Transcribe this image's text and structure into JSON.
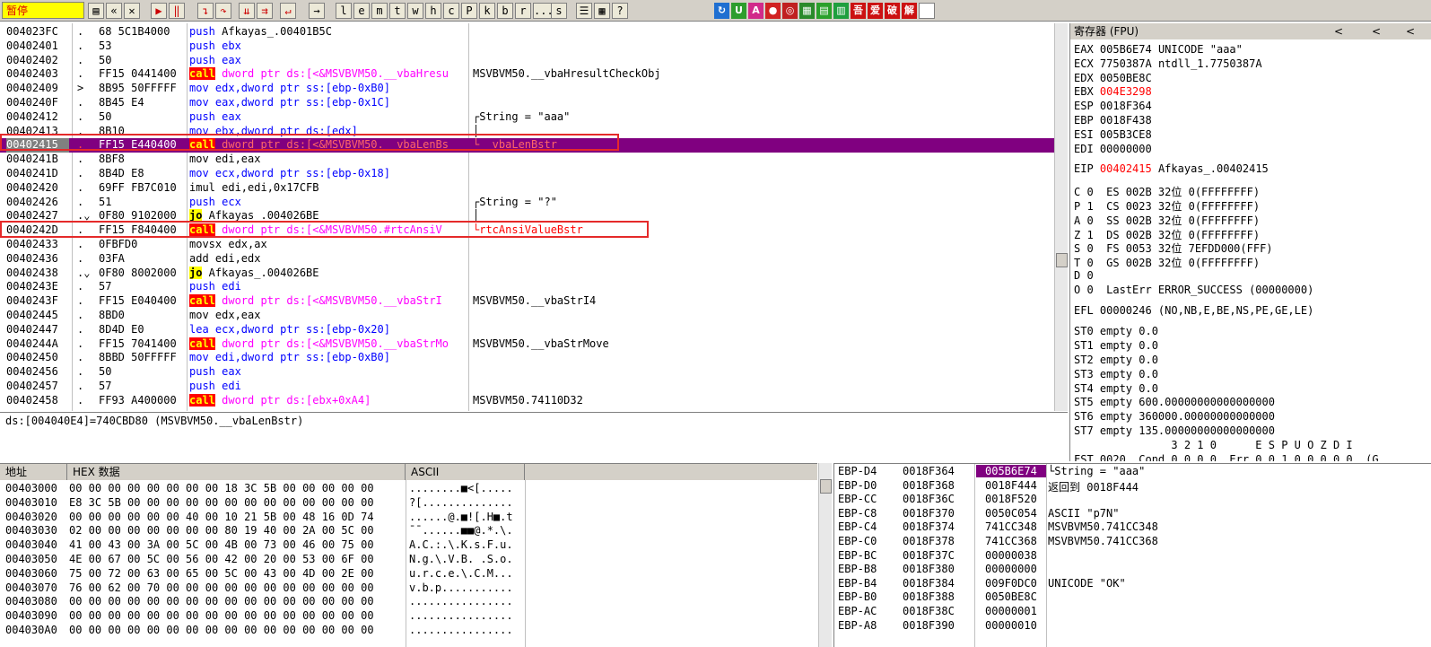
{
  "toolbar": {
    "status": "暂停",
    "buttons": [
      "l",
      "e",
      "m",
      "t",
      "w",
      "h",
      "c",
      "P",
      "k",
      "b",
      "r",
      "...",
      "s"
    ],
    "plugin_buttons": [
      "吾",
      "爱",
      "破",
      "解"
    ]
  },
  "disasm": {
    "rows": [
      {
        "addr": "004023FC",
        "mark": ".",
        "hex": "68 5C1B4000",
        "asm": [
          [
            "push",
            "push"
          ],
          [
            " Afkayas_.00401B5C",
            "plain"
          ]
        ],
        "cmt": ""
      },
      {
        "addr": "00402401",
        "mark": ".",
        "hex": "53",
        "asm": [
          [
            "push",
            "push"
          ],
          [
            " ebx",
            "push"
          ]
        ],
        "cmt": ""
      },
      {
        "addr": "00402402",
        "mark": ".",
        "hex": "50",
        "asm": [
          [
            "push",
            "push"
          ],
          [
            " eax",
            "push"
          ]
        ],
        "cmt": ""
      },
      {
        "addr": "00402403",
        "mark": ".",
        "hex": "FF15 0441400",
        "asm": [
          [
            "call",
            "call"
          ],
          [
            " dword ptr ds:[<&MSVBVM50.__vbaHresu",
            "ds"
          ]
        ],
        "cmt": "MSVBVM50.__vbaHresultCheckObj"
      },
      {
        "addr": "00402409",
        "mark": ">",
        "hex": "8B95 50FFFFF",
        "asm": [
          [
            "mov edx,dword ptr ss:[ebp-0xB0]",
            "ptr"
          ]
        ],
        "cmt": ""
      },
      {
        "addr": "0040240F",
        "mark": ".",
        "hex": "8B45 E4",
        "asm": [
          [
            "mov eax,dword ptr ss:[ebp-0x1C]",
            "ptr"
          ]
        ],
        "cmt": ""
      },
      {
        "addr": "00402412",
        "mark": ".",
        "hex": "50",
        "asm": [
          [
            "push",
            "push"
          ],
          [
            " eax",
            "push"
          ]
        ],
        "cmt": "┌String = \"aaa\""
      },
      {
        "addr": "00402413",
        "mark": ".",
        "hex": "8B10",
        "asm": [
          [
            "mov ebx,dword ptr ds:[edx]",
            "ptr"
          ]
        ],
        "cmt": "│"
      },
      {
        "addr": "00402415",
        "mark": ".",
        "hex": "FF15 E440400",
        "asm": [
          [
            "call",
            "call"
          ],
          [
            " dword ptr ds:[<&MSVBVM50.__vbaLenBs",
            "ds"
          ]
        ],
        "cmt": "└__vbaLenBstr",
        "hi": true
      },
      {
        "addr": "0040241B",
        "mark": ".",
        "hex": "8BF8",
        "asm": [
          [
            "mov edi,eax",
            "plain"
          ]
        ],
        "cmt": ""
      },
      {
        "addr": "0040241D",
        "mark": ".",
        "hex": "8B4D E8",
        "asm": [
          [
            "mov ecx,dword ptr ss:[ebp-0x18]",
            "ptr"
          ]
        ],
        "cmt": ""
      },
      {
        "addr": "00402420",
        "mark": ".",
        "hex": "69FF FB7C010",
        "asm": [
          [
            "imul edi,edi,0x17CFB",
            "plain"
          ]
        ],
        "cmt": ""
      },
      {
        "addr": "00402426",
        "mark": ".",
        "hex": "51",
        "asm": [
          [
            "push",
            "push"
          ],
          [
            " ecx",
            "push"
          ]
        ],
        "cmt": "┌String = \"?\""
      },
      {
        "addr": "00402427",
        "mark": ".⌄",
        "hex": "0F80 9102000",
        "asm": [
          [
            "jo",
            "jo"
          ],
          [
            " Afkayas_.004026BE",
            "plain"
          ]
        ],
        "cmt": "│"
      },
      {
        "addr": "0040242D",
        "mark": ".",
        "hex": "FF15 F840400",
        "asm": [
          [
            "call",
            "call"
          ],
          [
            " dword ptr ds:[<&MSVBVM50.#rtcAnsiV",
            "ds"
          ]
        ],
        "cmt": "└rtcAnsiValueBstr",
        "redcmt": true
      },
      {
        "addr": "00402433",
        "mark": ".",
        "hex": "0FBFD0",
        "asm": [
          [
            "movsx edx,ax",
            "plain"
          ]
        ],
        "cmt": ""
      },
      {
        "addr": "00402436",
        "mark": ".",
        "hex": "03FA",
        "asm": [
          [
            "add edi,edx",
            "plain"
          ]
        ],
        "cmt": ""
      },
      {
        "addr": "00402438",
        "mark": ".⌄",
        "hex": "0F80 8002000",
        "asm": [
          [
            "jo",
            "jo"
          ],
          [
            " Afkayas_.004026BE",
            "plain"
          ]
        ],
        "cmt": ""
      },
      {
        "addr": "0040243E",
        "mark": ".",
        "hex": "57",
        "asm": [
          [
            "push",
            "push"
          ],
          [
            " edi",
            "push"
          ]
        ],
        "cmt": ""
      },
      {
        "addr": "0040243F",
        "mark": ".",
        "hex": "FF15 E040400",
        "asm": [
          [
            "call",
            "call"
          ],
          [
            " dword ptr ds:[<&MSVBVM50.__vbaStrI",
            "ds"
          ]
        ],
        "cmt": "MSVBVM50.__vbaStrI4"
      },
      {
        "addr": "00402445",
        "mark": ".",
        "hex": "8BD0",
        "asm": [
          [
            "mov edx,eax",
            "plain"
          ]
        ],
        "cmt": ""
      },
      {
        "addr": "00402447",
        "mark": ".",
        "hex": "8D4D E0",
        "asm": [
          [
            "lea ecx,dword ptr ss:[ebp-0x20]",
            "ptr"
          ]
        ],
        "cmt": ""
      },
      {
        "addr": "0040244A",
        "mark": ".",
        "hex": "FF15 7041400",
        "asm": [
          [
            "call",
            "call"
          ],
          [
            " dword ptr ds:[<&MSVBVM50.__vbaStrMo",
            "ds"
          ]
        ],
        "cmt": "MSVBVM50.__vbaStrMove"
      },
      {
        "addr": "00402450",
        "mark": ".",
        "hex": "8BBD 50FFFFF",
        "asm": [
          [
            "mov edi,dword ptr ss:[ebp-0xB0]",
            "ptr"
          ]
        ],
        "cmt": ""
      },
      {
        "addr": "00402456",
        "mark": ".",
        "hex": "50",
        "asm": [
          [
            "push",
            "push"
          ],
          [
            " eax",
            "push"
          ]
        ],
        "cmt": ""
      },
      {
        "addr": "00402457",
        "mark": ".",
        "hex": "57",
        "asm": [
          [
            "push",
            "push"
          ],
          [
            " edi",
            "push"
          ]
        ],
        "cmt": ""
      },
      {
        "addr": "00402458",
        "mark": ".",
        "hex": "FF93 A400000",
        "asm": [
          [
            "call",
            "call"
          ],
          [
            " dword ptr ds:[ebx+0xA4]",
            "ds"
          ]
        ],
        "cmt": "MSVBVM50.74110D32"
      }
    ]
  },
  "info_line": "ds:[004040E4]=740CBD80 (MSVBVM50.__vbaLenBstr)",
  "registers": {
    "title": "寄存器 (FPU)",
    "gp": [
      {
        "name": "EAX",
        "val": "005B6E74",
        "note": "UNICODE \"aaa\""
      },
      {
        "name": "ECX",
        "val": "7750387A",
        "note": "ntdll_1.7750387A"
      },
      {
        "name": "EDX",
        "val": "0050BE8C",
        "note": ""
      },
      {
        "name": "EBX",
        "val": "004E3298",
        "note": "",
        "red": true
      },
      {
        "name": "ESP",
        "val": "0018F364",
        "note": ""
      },
      {
        "name": "EBP",
        "val": "0018F438",
        "note": ""
      },
      {
        "name": "ESI",
        "val": "005B3CE8",
        "note": ""
      },
      {
        "name": "EDI",
        "val": "00000000",
        "note": ""
      }
    ],
    "eip": {
      "name": "EIP",
      "val": "00402415",
      "note": "Afkayas_.00402415"
    },
    "flags": [
      "C 0  ES 002B 32位 0(FFFFFFFF)",
      "P 1  CS 0023 32位 0(FFFFFFFF)",
      "A 0  SS 002B 32位 0(FFFFFFFF)",
      "Z 1  DS 002B 32位 0(FFFFFFFF)",
      "S 0  FS 0053 32位 7EFDD000(FFF)",
      "T 0  GS 002B 32位 0(FFFFFFFF)",
      "D 0",
      "O 0  LastErr ERROR_SUCCESS (00000000)"
    ],
    "efl": "EFL 00000246 (NO,NB,E,BE,NS,PE,GE,LE)",
    "fpu": [
      "ST0 empty 0.0",
      "ST1 empty 0.0",
      "ST2 empty 0.0",
      "ST3 empty 0.0",
      "ST4 empty 0.0",
      "ST5 empty 600.00000000000000000",
      "ST6 empty 360000.00000000000000",
      "ST7 empty 135.00000000000000000"
    ],
    "fpu_bits": "               3 2 1 0      E S P U O Z D I",
    "fst": "FST 0020  Cond 0 0 0 0  Err 0 0 1 0 0 0 0 0  (G"
  },
  "dump": {
    "col_addr": "地址",
    "col_hex": "HEX 数据",
    "col_ascii": "ASCII",
    "rows": [
      {
        "addr": "00403000",
        "hex": "00 00 00 00 00 00 00 00 18 3C 5B 00 00 00 00 00",
        "ascii": "........■<[....."
      },
      {
        "addr": "00403010",
        "hex": "E8 3C 5B 00 00 00 00 00 00 00 00 00 00 00 00 00",
        "ascii": "?[.............."
      },
      {
        "addr": "00403020",
        "hex": "00 00 00 00 00 00 40 00 10 21 5B 00 48 16 0D 74",
        "ascii": "......@.■![.H■.t"
      },
      {
        "addr": "00403030",
        "hex": "02 00 00 00 00 00 00 00 80 19 40 00 2A 00 5C 00",
        "ascii": "¯ˉ......■■@.*.\\."
      },
      {
        "addr": "00403040",
        "hex": "41 00 43 00 3A 00 5C 00 4B 00 73 00 46 00 75 00",
        "ascii": "A.C.:.\\.K.s.F.u."
      },
      {
        "addr": "00403050",
        "hex": "4E 00 67 00 5C 00 56 00 42 00 20 00 53 00 6F 00",
        "ascii": "N.g.\\.V.B. .S.o."
      },
      {
        "addr": "00403060",
        "hex": "75 00 72 00 63 00 65 00 5C 00 43 00 4D 00 2E 00",
        "ascii": "u.r.c.e.\\.C.M..."
      },
      {
        "addr": "00403070",
        "hex": "76 00 62 00 70 00 00 00 00 00 00 00 00 00 00 00",
        "ascii": "v.b.p..........."
      },
      {
        "addr": "00403080",
        "hex": "00 00 00 00 00 00 00 00 00 00 00 00 00 00 00 00",
        "ascii": "................"
      },
      {
        "addr": "00403090",
        "hex": "00 00 00 00 00 00 00 00 00 00 00 00 00 00 00 00",
        "ascii": "................"
      },
      {
        "addr": "004030A0",
        "hex": "00 00 00 00 00 00 00 00 00 00 00 00 00 00 00 00",
        "ascii": "................"
      }
    ]
  },
  "stack": {
    "rows": [
      {
        "label": "EBP-D4",
        "addr": "0018F364",
        "val": "005B6E74",
        "cmt": "└String = \"aaa\"",
        "sel": true
      },
      {
        "label": "EBP-D0",
        "addr": "0018F368",
        "val": "0018F444",
        "cmt": "返回到 0018F444"
      },
      {
        "label": "EBP-CC",
        "addr": "0018F36C",
        "val": "0018F520",
        "cmt": ""
      },
      {
        "label": "EBP-C8",
        "addr": "0018F370",
        "val": "0050C054",
        "cmt": "ASCII \"p7N\""
      },
      {
        "label": "EBP-C4",
        "addr": "0018F374",
        "val": "741CC348",
        "cmt": "MSVBVM50.741CC348"
      },
      {
        "label": "EBP-C0",
        "addr": "0018F378",
        "val": "741CC368",
        "cmt": "MSVBVM50.741CC368"
      },
      {
        "label": "EBP-BC",
        "addr": "0018F37C",
        "val": "00000038",
        "cmt": ""
      },
      {
        "label": "EBP-B8",
        "addr": "0018F380",
        "val": "00000000",
        "cmt": ""
      },
      {
        "label": "EBP-B4",
        "addr": "0018F384",
        "val": "009F0DC0",
        "cmt": "UNICODE \"OK\""
      },
      {
        "label": "EBP-B0",
        "addr": "0018F388",
        "val": "0050BE8C",
        "cmt": ""
      },
      {
        "label": "EBP-AC",
        "addr": "0018F38C",
        "val": "00000001",
        "cmt": ""
      },
      {
        "label": "EBP-A8",
        "addr": "0018F390",
        "val": "00000010",
        "cmt": ""
      }
    ]
  }
}
